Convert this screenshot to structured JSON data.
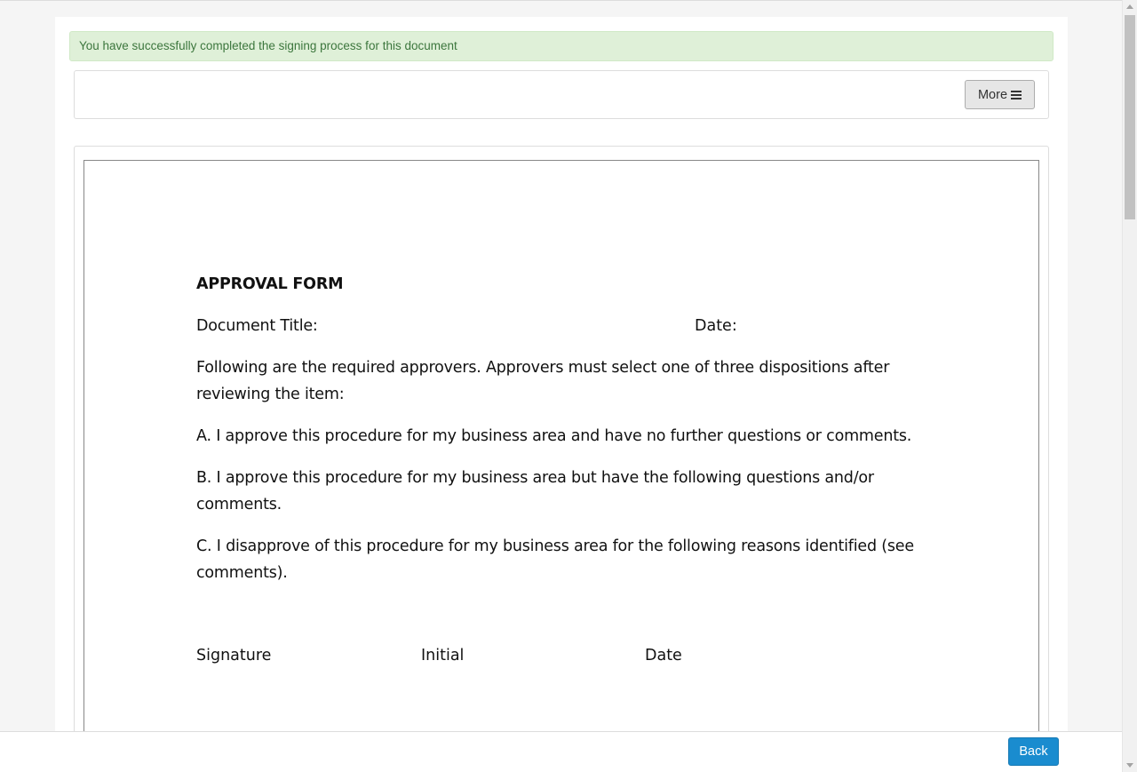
{
  "alert": {
    "message": "You have successfully completed the signing process for this document"
  },
  "toolbar": {
    "more_label": "More",
    "more_icon": "hamburger-icon"
  },
  "document": {
    "title": "APPROVAL FORM",
    "document_title_label": "Document Title:",
    "date_label": "Date:",
    "intro": "Following are the required approvers. Approvers must select one of three dispositions after reviewing the item:",
    "options": [
      "A. I approve this procedure for my business area and have no further questions or comments.",
      "B. I approve this procedure for my business area but have the following questions and/or comments.",
      "C. I disapprove of this procedure for my business area for the following reasons identified (see comments)."
    ],
    "signature_columns": [
      "Signature",
      "Initial",
      "Date"
    ]
  },
  "footer": {
    "back_label": "Back"
  },
  "colors": {
    "alert_bg": "#dff0d8",
    "alert_text": "#3c763d",
    "primary_button": "#1a8ccf"
  }
}
